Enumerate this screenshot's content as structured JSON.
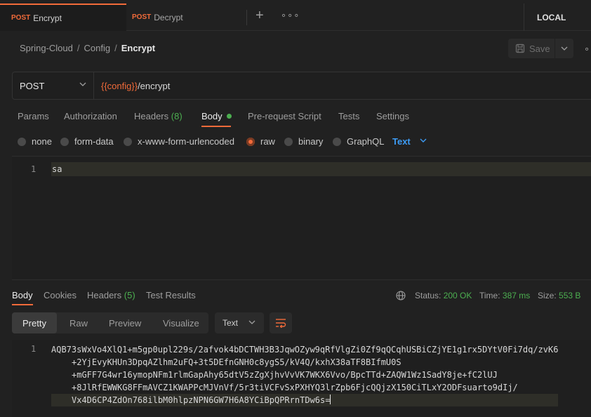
{
  "tabs": [
    {
      "method": "POST",
      "name": "Encrypt"
    },
    {
      "method": "POST",
      "name": "Decrypt"
    }
  ],
  "environment": "LOCAL",
  "breadcrumb": {
    "items": [
      "Spring-Cloud",
      "Config"
    ],
    "current": "Encrypt",
    "separator": "/"
  },
  "save_label": "Save",
  "request": {
    "method": "POST",
    "url_variable": "{{config}}",
    "url_path": "/encrypt"
  },
  "request_tabs": {
    "params": "Params",
    "authorization": "Authorization",
    "headers": "Headers",
    "headers_count": "(8)",
    "body": "Body",
    "pre_request": "Pre-request Script",
    "tests": "Tests",
    "settings": "Settings"
  },
  "body_types": [
    "none",
    "form-data",
    "x-www-form-urlencoded",
    "raw",
    "binary",
    "GraphQL"
  ],
  "body_type_selected": "raw",
  "body_language": "Text",
  "request_body": {
    "line_number": "1",
    "content": "sa"
  },
  "response_tabs": {
    "body": "Body",
    "cookies": "Cookies",
    "headers": "Headers",
    "headers_count": "(5)",
    "test_results": "Test Results"
  },
  "response_status": {
    "status_label": "Status:",
    "status_value": "200 OK",
    "time_label": "Time:",
    "time_value": "387 ms",
    "size_label": "Size:",
    "size_value": "553 B"
  },
  "response_formats": [
    "Pretty",
    "Raw",
    "Preview",
    "Visualize"
  ],
  "response_format_selected": "Pretty",
  "response_language": "Text",
  "response_body": {
    "line_number": "1",
    "lines": [
      "AQB73sWxVo4XlQ1+m5gp0upl229s/2afvok4bDCTWH3B3JqwOZyw9qRfVlgZi0Zf9qQCqhUSBiCZjYE1g1rx5DYtV0Fi7dq/zvK6",
      "+2YjEvyKHUn3DpqAZlhm2uFQ+3t5DEfnGNH0c8ygS5/kV4Q/kxhX38aTF8BIfmU0S",
      "+mGFF7G4wr16ymopNFm1rlmGapAhy65dtV5zZgXjhvVvVK7WKX6Vvo/BpcTTd+ZAQW1Wz1SadY8je+fC2lUJ",
      "+8JlRfEWWKG8FFmAVCZ1KWAPPcMJVnVf/5r3tiVCFvSxPXHYQ3lrZpb6FjcQQjzX150CiTLxY2ODFsuarto9dIj/",
      "Vx4D6CP4ZdOn768ilbM0hlpzNPN6GW7H6A8YCiBpQPRrnTDw6s="
    ]
  }
}
